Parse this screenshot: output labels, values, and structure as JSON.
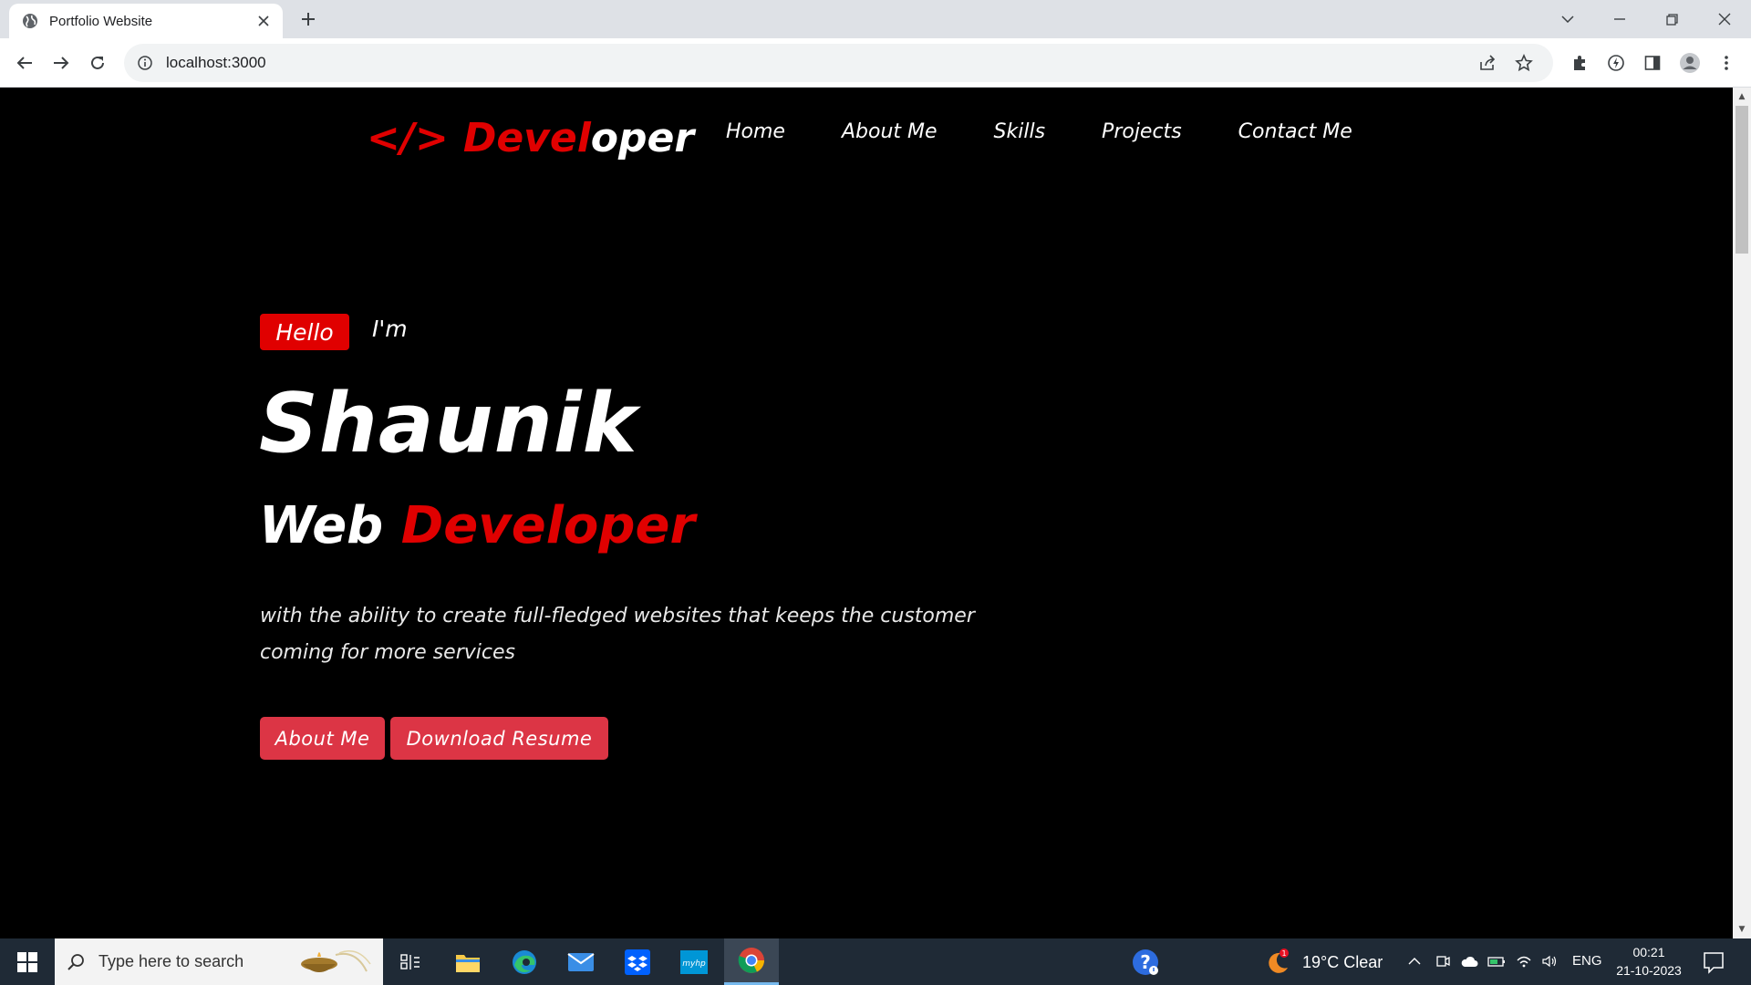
{
  "browser": {
    "tab_title": "Portfolio Website",
    "url": "localhost:3000"
  },
  "page": {
    "logo": {
      "code_symbol": "</>",
      "red_part": "Devel",
      "white_part": "oper"
    },
    "nav": [
      {
        "label": "Home"
      },
      {
        "label": "About Me"
      },
      {
        "label": "Skills"
      },
      {
        "label": "Projects"
      },
      {
        "label": "Contact Me"
      }
    ],
    "hero": {
      "badge": "Hello",
      "intro": "I'm",
      "name": "Shaunik",
      "role_white": "Web",
      "role_red": "Developer",
      "description": "with the ability to create full-fledged websites that keeps the customer coming for more services",
      "buttons": {
        "about": "About Me",
        "resume": "Download Resume"
      }
    },
    "colors": {
      "accent_red": "#e00000",
      "button_red": "#dc3545",
      "background": "#000000"
    }
  },
  "taskbar": {
    "search_placeholder": "Type here to search",
    "weather": "19°C  Clear",
    "weather_badge": "1",
    "language": "ENG",
    "time": "00:21",
    "date": "21-10-2023"
  }
}
